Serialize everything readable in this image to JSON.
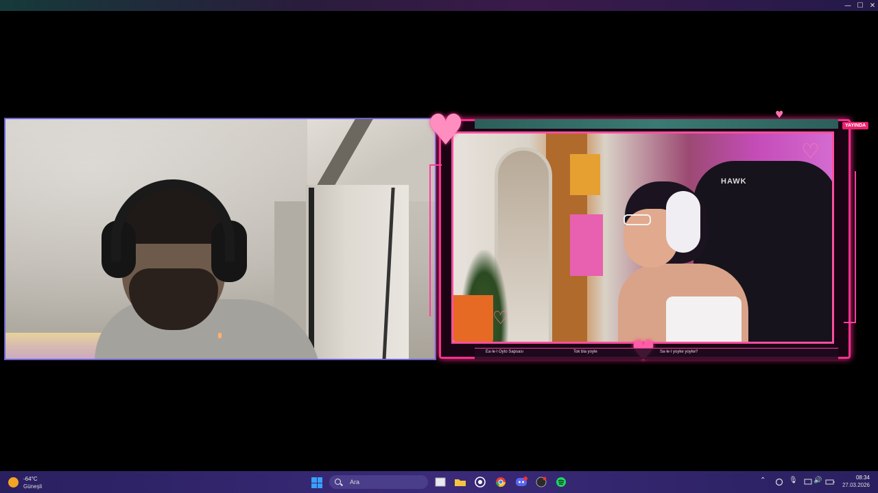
{
  "window": {
    "minimize_glyph": "—",
    "maximize_glyph": "☐",
    "close_glyph": "✕"
  },
  "left_cam": {
    "border_color": "#6b63d8"
  },
  "stream": {
    "live_badge": "YAYINDA",
    "chair_brand": "HAWK",
    "accent": "#ff2f8e",
    "chat": [
      "Ea·le·l Oyto Sapsası",
      "Tok bla yoyle",
      "Sa·le·l yoyke yoyke?"
    ]
  },
  "taskbar": {
    "weather": {
      "temp": "-64°C",
      "condition": "Güneşli",
      "icon": "sun-icon"
    },
    "search_placeholder": "Ara",
    "apps": [
      {
        "name": "file-explorer-icon"
      },
      {
        "name": "folder-icon"
      },
      {
        "name": "whatsapp-icon"
      },
      {
        "name": "chrome-icon"
      },
      {
        "name": "discord-icon"
      },
      {
        "name": "app-icon"
      },
      {
        "name": "spotify-icon"
      }
    ],
    "tray": {
      "chevron": "⌃",
      "mic": "🎙",
      "volume": "🔊"
    },
    "time": "08:34",
    "date": "27.03.2026"
  }
}
